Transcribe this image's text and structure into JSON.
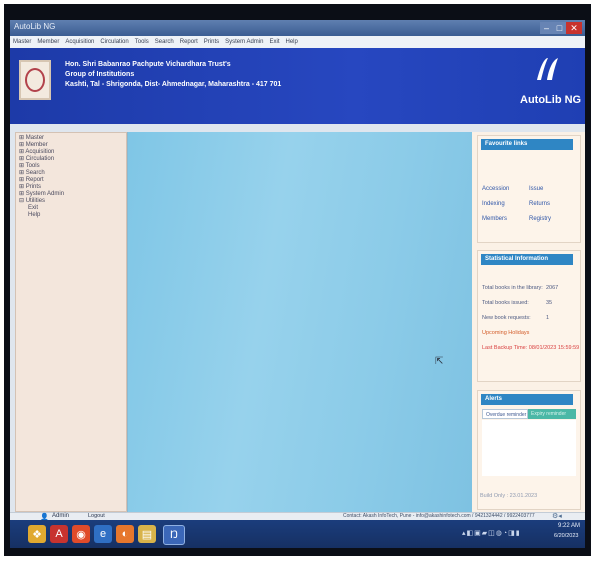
{
  "window": {
    "title": "AutoLib NG",
    "menu": [
      "Master",
      "Member",
      "Acquisition",
      "Circulation",
      "Tools",
      "Search",
      "Report",
      "Prints",
      "System Admin",
      "Exit",
      "Help"
    ]
  },
  "header": {
    "org_line1": "Hon. Shri Babanrao Pachpute Vichardhara Trust's",
    "org_line2": "Group of Institutions",
    "org_line3": "Kashti, Tal - Shrigonda, Dist- Ahmednagar, Maharashtra - 417 701",
    "brand": "AutoLib NG",
    "brand_color": "#1f3fb3"
  },
  "leftnav": {
    "items": [
      {
        "label": "⊞ Master",
        "sub": false
      },
      {
        "label": "⊞ Member",
        "sub": false
      },
      {
        "label": "⊞ Acquisition",
        "sub": false
      },
      {
        "label": "⊞ Circulation",
        "sub": false
      },
      {
        "label": "⊞ Tools",
        "sub": false
      },
      {
        "label": "⊞ Search",
        "sub": false
      },
      {
        "label": "⊞ Report",
        "sub": false
      },
      {
        "label": "⊞ Prints",
        "sub": false
      },
      {
        "label": "⊞ System Admin",
        "sub": false
      },
      {
        "label": "⊟ Utilities",
        "sub": false
      },
      {
        "label": "Exit",
        "sub": true
      },
      {
        "label": "Help",
        "sub": true
      }
    ]
  },
  "favourites": {
    "title": "Favourite links",
    "links": [
      "Accession",
      "Issue",
      "Indexing",
      "Returns",
      "Members",
      "Registry"
    ]
  },
  "stats": {
    "title": "Statistical Information",
    "total_books_label": "Total books in the library:",
    "total_books_value": "2067",
    "issued_label": "Total books issued:",
    "issued_value": "35",
    "requests_label": "New book requests:",
    "requests_value": "1",
    "holidays_label": "Upcoming Holidays",
    "backup_label": "Last Backup Time: 08/01/2023 15:59:59"
  },
  "alerts": {
    "title": "Alerts",
    "tab_active": "Overdue reminder",
    "tab_inactive": "Expiry reminder",
    "build": "Build Only : 23.01.2023"
  },
  "status": {
    "user": "Admin",
    "logout": "Logout",
    "contact": "Contact: Akash InfoTech, Pune - info@akashinfotech.com / 9421324442 / 9922403777"
  },
  "taskbar": {
    "time": "9:22 AM",
    "date": "6/20/2023"
  }
}
